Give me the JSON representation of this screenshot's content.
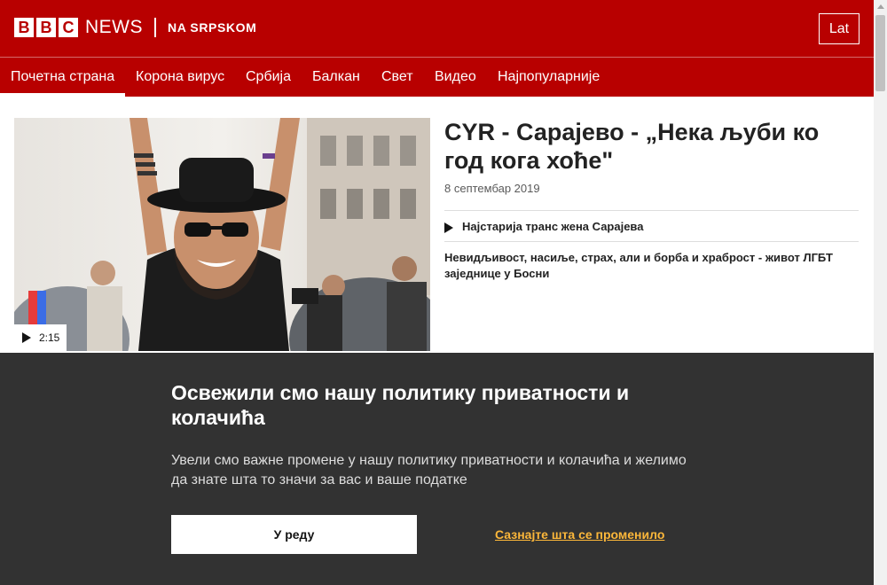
{
  "header": {
    "logo_letters": [
      "B",
      "B",
      "C"
    ],
    "logo_word": "NEWS",
    "service_name": "NA SRPSKOM",
    "script_toggle_label": "Lat",
    "brand_color": "#b80000"
  },
  "nav": {
    "items": [
      {
        "label": "Почетна страна",
        "active": true
      },
      {
        "label": "Корона вирус",
        "active": false
      },
      {
        "label": "Србија",
        "active": false
      },
      {
        "label": "Балкан",
        "active": false
      },
      {
        "label": "Свет",
        "active": false
      },
      {
        "label": "Видео",
        "active": false
      },
      {
        "label": "Најпопуларније",
        "active": false
      }
    ]
  },
  "article": {
    "headline": "CYR - Сарајево - „Нека љуби ко год кога хоће\"",
    "date": "8 септембар 2019",
    "video_duration": "2:15",
    "related_video_title": "Најстарија транс жена Сарајева",
    "summary": "Невидљивост, насиље, страх, али и борба и храброст - живот ЛГБТ заједнице у Босни"
  },
  "privacy_banner": {
    "title": "Освежили смо нашу политику приватности и колачића",
    "body": "Увели смо важне промене у нашу политику приватности и колачића и желимо да знате шта то значи за вас и ваше податке",
    "accept_label": "У реду",
    "learn_more_label": "Сазнајте шта се променило",
    "link_color": "#fcb73a"
  }
}
